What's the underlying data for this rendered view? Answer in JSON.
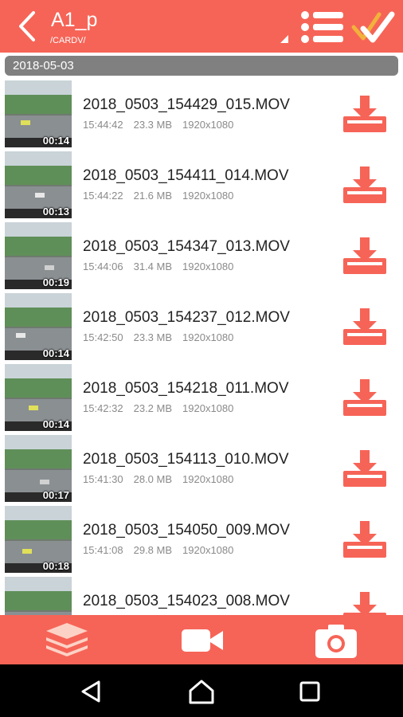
{
  "header": {
    "title": "A1_p",
    "path": "/CARDV/",
    "icons": {
      "back": "chevron-left-icon",
      "list": "list-icon",
      "select": "double-check-icon"
    }
  },
  "date_header": "2018-05-03",
  "files": [
    {
      "name": "2018_0503_154429_015.MOV",
      "time": "15:44:42",
      "size": "23.3 MB",
      "resolution": "1920x1080",
      "duration": "00:14"
    },
    {
      "name": "2018_0503_154411_014.MOV",
      "time": "15:44:22",
      "size": "21.6 MB",
      "resolution": "1920x1080",
      "duration": "00:13"
    },
    {
      "name": "2018_0503_154347_013.MOV",
      "time": "15:44:06",
      "size": "31.4 MB",
      "resolution": "1920x1080",
      "duration": "00:19"
    },
    {
      "name": "2018_0503_154237_012.MOV",
      "time": "15:42:50",
      "size": "23.3 MB",
      "resolution": "1920x1080",
      "duration": "00:14"
    },
    {
      "name": "2018_0503_154218_011.MOV",
      "time": "15:42:32",
      "size": "23.2 MB",
      "resolution": "1920x1080",
      "duration": "00:14"
    },
    {
      "name": "2018_0503_154113_010.MOV",
      "time": "15:41:30",
      "size": "28.0 MB",
      "resolution": "1920x1080",
      "duration": "00:17"
    },
    {
      "name": "2018_0503_154050_009.MOV",
      "time": "15:41:08",
      "size": "29.8 MB",
      "resolution": "1920x1080",
      "duration": "00:18"
    },
    {
      "name": "2018_0503_154023_008.MOV",
      "time": "",
      "size": "",
      "resolution": "",
      "duration": ""
    }
  ],
  "bottom_tabs": [
    "layers-icon",
    "video-camera-icon",
    "camera-icon"
  ],
  "system_nav": [
    "back-triangle-icon",
    "home-icon",
    "recents-icon"
  ],
  "colors": {
    "accent": "#f66457",
    "date_bar": "#808080",
    "nav_bar": "#000000"
  }
}
